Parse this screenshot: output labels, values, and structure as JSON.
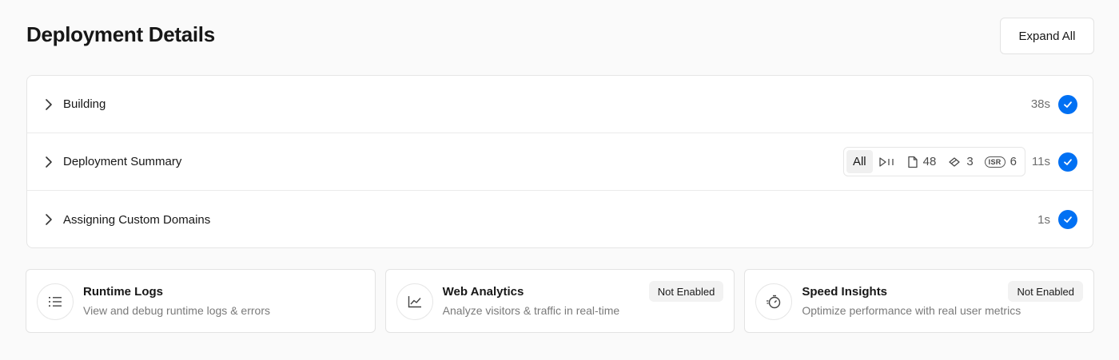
{
  "header": {
    "title": "Deployment Details",
    "expand_label": "Expand All"
  },
  "steps": [
    {
      "label": "Building",
      "duration": "38s",
      "status": "success"
    },
    {
      "label": "Deployment Summary",
      "duration": "11s",
      "status": "success",
      "filters": {
        "all": "All",
        "static_icon": "play-pause-icon",
        "files": "48",
        "functions": "3",
        "isr_badge": "ISR",
        "isr": "6"
      }
    },
    {
      "label": "Assigning Custom Domains",
      "duration": "1s",
      "status": "success"
    }
  ],
  "cards": [
    {
      "title": "Runtime Logs",
      "description": "View and debug runtime logs & errors",
      "badge": "",
      "icon": "list-icon"
    },
    {
      "title": "Web Analytics",
      "description": "Analyze visitors & traffic in real-time",
      "badge": "Not Enabled",
      "icon": "chart-line-icon"
    },
    {
      "title": "Speed Insights",
      "description": "Optimize performance with real user metrics",
      "badge": "Not Enabled",
      "icon": "stopwatch-icon"
    }
  ],
  "colors": {
    "accent": "#0070f3",
    "background": "#fafafa"
  }
}
